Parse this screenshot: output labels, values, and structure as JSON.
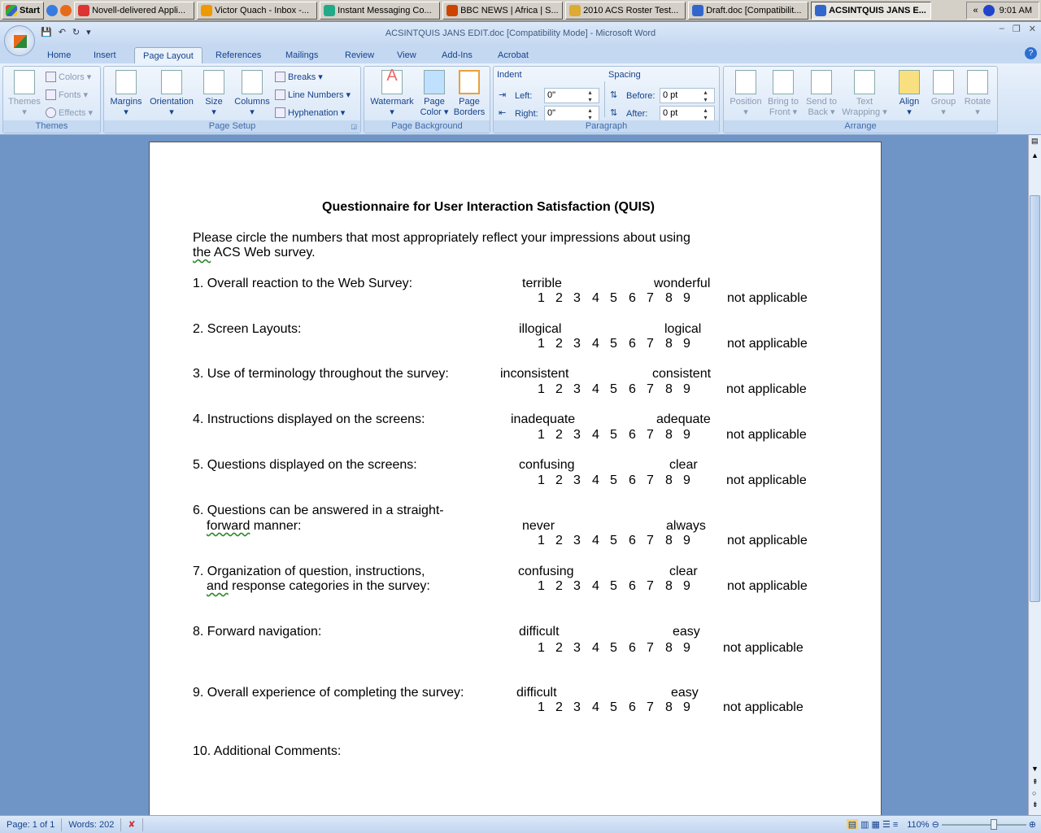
{
  "taskbar": {
    "start": "Start",
    "items": [
      "Novell-delivered Appli...",
      "Victor Quach - Inbox -...",
      "Instant Messaging Co...",
      "BBC NEWS | Africa | S...",
      "2010 ACS Roster Test...",
      "Draft.doc [Compatibilit...",
      "ACSINTQUIS JANS E..."
    ],
    "active_index": 6,
    "clock": "9:01 AM"
  },
  "window": {
    "title": "ACSINTQUIS JANS EDIT.doc [Compatibility Mode] - Microsoft Word"
  },
  "tabs": [
    "Home",
    "Insert",
    "Page Layout",
    "References",
    "Mailings",
    "Review",
    "View",
    "Add-Ins",
    "Acrobat"
  ],
  "selected_tab": "Page Layout",
  "ribbon": {
    "themes": {
      "label": "Themes",
      "themes": "Themes",
      "colors": "Colors",
      "fonts": "Fonts",
      "effects": "Effects"
    },
    "page_setup": {
      "label": "Page Setup",
      "margins": "Margins",
      "orientation": "Orientation",
      "size": "Size",
      "columns": "Columns",
      "breaks": "Breaks",
      "line_numbers": "Line Numbers",
      "hyphenation": "Hyphenation"
    },
    "page_background": {
      "label": "Page Background",
      "watermark": "Watermark",
      "page_color": "Page Color",
      "page_borders": "Page Borders"
    },
    "paragraph": {
      "label": "Paragraph",
      "indent": "Indent",
      "left_label": "Left:",
      "left_value": "0\"",
      "right_label": "Right:",
      "right_value": "0\"",
      "spacing": "Spacing",
      "before_label": "Before:",
      "before_value": "0 pt",
      "after_label": "After:",
      "after_value": "0 pt"
    },
    "arrange": {
      "label": "Arrange",
      "position": "Position",
      "bring_to_front": "Bring to Front",
      "send_to_back": "Send to Back",
      "text_wrapping": "Text Wrapping",
      "align": "Align",
      "group": "Group",
      "rotate": "Rotate"
    }
  },
  "document": {
    "title": "Questionnaire for User Interaction  Satisfaction  (QUIS)",
    "intro_line1": "Please circle the numbers that most appropriately reflect your impressions about using",
    "intro_line2_sq": "the",
    "intro_line2": " ACS Web survey.",
    "scale": [
      "1",
      "2",
      "3",
      "4",
      "5",
      "6",
      "7",
      "8",
      "9"
    ],
    "na": "not applicable",
    "questions": [
      {
        "text": "1. Overall reaction to the Web Survey:",
        "low": "terrible",
        "high": "wonderful"
      },
      {
        "text": "2. Screen Layouts:",
        "low": "illogical",
        "high": "logical"
      },
      {
        "text": "3. Use of terminology throughout the survey:",
        "low": "inconsistent",
        "high": "consistent"
      },
      {
        "text": "4. Instructions displayed on the screens:",
        "low": "inadequate",
        "high": "adequate"
      },
      {
        "text": "5. Questions displayed on the screens:",
        "low": "confusing",
        "high": "clear"
      },
      {
        "text": "6. Questions can be answered in a straight-",
        "text2_sq": "forward",
        "text2": " manner:",
        "low": "never",
        "high": "always"
      },
      {
        "text": "7. Organization of question, instructions,",
        "text2_sq": "and",
        "text2": " response categories in the survey:",
        "low": "confusing",
        "high": "clear"
      },
      {
        "text": "8. Forward navigation:",
        "low": "difficult",
        "high": "easy"
      },
      {
        "text": "9. Overall experience of completing the survey:",
        "low": "difficult",
        "high": "easy"
      }
    ],
    "comments": "10. Additional Comments:"
  },
  "status": {
    "page": "Page: 1 of 1",
    "words": "Words: 202",
    "zoom": "110%"
  }
}
